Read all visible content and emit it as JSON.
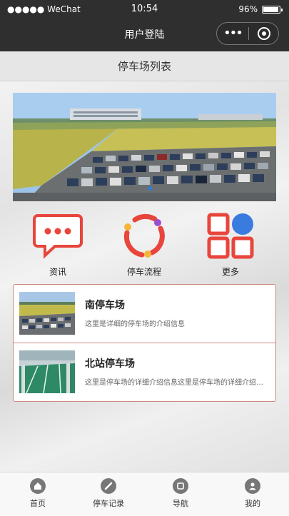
{
  "status_bar": {
    "signal": "●●●●● WeChat",
    "time": "10:54",
    "battery": "96%"
  },
  "nav": {
    "title": "用户登陆",
    "more_icon": "more-dots-icon",
    "close_icon": "target-icon"
  },
  "page": {
    "title": "停车场列表"
  },
  "banner": {
    "image": "parking-lot-aerial-photo"
  },
  "shortcuts": [
    {
      "label": "资讯",
      "icon": "chat-bubble-icon"
    },
    {
      "label": "停车流程",
      "icon": "cycle-icon"
    },
    {
      "label": "更多",
      "icon": "grid-more-icon"
    }
  ],
  "parking_list": [
    {
      "title": "南停车场",
      "desc": "这里是详细的停车场的介绍信息",
      "thumb": "parking-lot-photo"
    },
    {
      "title": "北站停车场",
      "desc": "这里是停车场的详细介绍信息这里是停车场的详细介绍信息",
      "thumb": "parking-garage-photo"
    }
  ],
  "tabbar": [
    {
      "label": "首页",
      "icon": "home-icon"
    },
    {
      "label": "停车记录",
      "icon": "record-icon"
    },
    {
      "label": "导航",
      "icon": "navigation-icon"
    },
    {
      "label": "我的",
      "icon": "user-icon"
    }
  ],
  "colors": {
    "nav_bg": "#2f2f2f",
    "accent_red": "#e8453c",
    "list_border": "#c98b7e"
  }
}
